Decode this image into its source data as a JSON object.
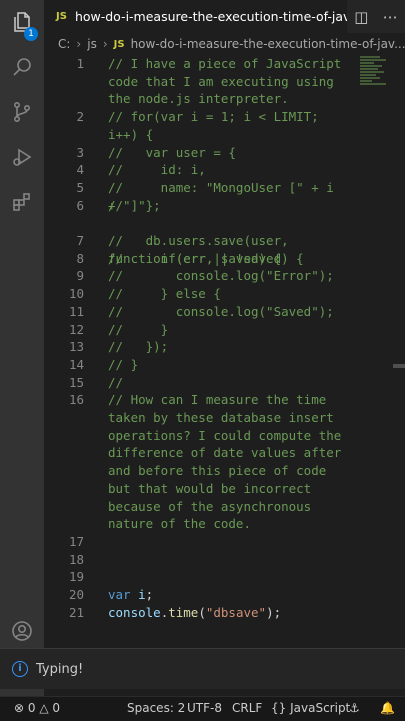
{
  "activity_bar": {
    "explorer_badge": "1"
  },
  "tab": {
    "lang_badge": "JS",
    "title": "how-do-i-measure-the-execution-time-of-javascript"
  },
  "breadcrumb": {
    "drive": "C:",
    "folder": "js",
    "lang_badge": "JS",
    "file": "how-do-i-measure-the-execution-time-of-jav..."
  },
  "editor": {
    "lines": [
      {
        "n": "1",
        "text": "// I have a piece of JavaScript code that I am executing using the node.js interpreter."
      },
      {
        "n": "2",
        "text": "// for(var i = 1; i < LIMIT; i++) {"
      },
      {
        "n": "3",
        "text": "//   var user = {"
      },
      {
        "n": "4",
        "text": "//     id: i,"
      },
      {
        "n": "5",
        "text": "//     name: \"MongoUser [\" + i + \"]\""
      },
      {
        "n": "6",
        "text": "//   };"
      },
      {
        "n": "7",
        "text": "//   db.users.save(user, function (err, saved) {"
      },
      {
        "n": "8",
        "text": "//     if(err || !saved) {"
      },
      {
        "n": "9",
        "text": "//       console.log(\"Error\");"
      },
      {
        "n": "10",
        "text": "//     } else {"
      },
      {
        "n": "11",
        "text": "//       console.log(\"Saved\");"
      },
      {
        "n": "12",
        "text": "//     }"
      },
      {
        "n": "13",
        "text": "//   });"
      },
      {
        "n": "14",
        "text": "// }"
      },
      {
        "n": "15",
        "text": "//"
      },
      {
        "n": "16",
        "text": "// How can I measure the time taken by these database insert operations? I could compute the difference of date values after and before this piece of code but that would be incorrect because of the asynchronous nature of the code."
      },
      {
        "n": "17",
        "text": ""
      },
      {
        "n": "18",
        "text": ""
      },
      {
        "n": "19",
        "text": ""
      },
      {
        "n": "20",
        "text": "var i;"
      },
      {
        "n": "21",
        "text": "console.time(\"dbsave\");"
      }
    ]
  },
  "notification": {
    "message": "Typing!"
  },
  "status_bar": {
    "errors": "0",
    "warnings": "0",
    "spaces": "Spaces: 2",
    "encoding": "UTF-8",
    "eol": "CRLF",
    "language": "JavaScript"
  },
  "colors": {
    "comment": "#6a9955",
    "keyword": "#569cd6",
    "string": "#ce9178",
    "accent": "#0078d4"
  }
}
